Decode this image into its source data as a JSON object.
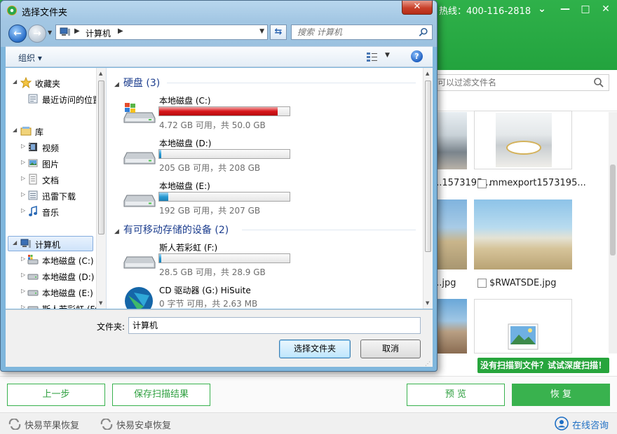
{
  "app": {
    "hotline": "热线：400-116-2818",
    "search_placeholder": "可以过滤文件名",
    "files": [
      {
        "name": "...1573195..."
      },
      {
        "name": "mmexport1573195..."
      },
      {
        "name": "...jpg"
      },
      {
        "name": "$RWATSDE.jpg"
      }
    ],
    "deep_scan": "没有扫描到文件？试试深度扫描！",
    "buttons": {
      "prev": "上一步",
      "save": "保存扫描结果",
      "preview": "预 览",
      "restore": "恢 复"
    },
    "footer": {
      "apple": "快易苹果恢复",
      "android": "快易安卓恢复",
      "online": "在线咨询"
    },
    "colors": {
      "brand_green": "#2fb14a",
      "link_blue": "#1e6fc4"
    }
  },
  "dialog": {
    "title": "选择文件夹",
    "address": "计算机",
    "search_placeholder": "搜索 计算机",
    "organize": "组织 ▾",
    "nav": {
      "favorites": "收藏夹",
      "recent": "最近访问的位置",
      "libraries": "库",
      "lib_items": [
        "视频",
        "图片",
        "文档",
        "迅雷下载",
        "音乐"
      ],
      "computer": "计算机",
      "computer_items": [
        "本地磁盘 (C:)",
        "本地磁盘 (D:)",
        "本地磁盘 (E:)",
        "斯人若彩虹 (F:)"
      ]
    },
    "groups": {
      "hard_disks": "硬盘 (3)",
      "removable": "有可移动存储的设备 (2)"
    },
    "drives": [
      {
        "name": "本地磁盘 (C:)",
        "info": "4.72 GB 可用，共 50.0 GB",
        "used": 0.906,
        "color": "red"
      },
      {
        "name": "本地磁盘 (D:)",
        "info": "205 GB 可用，共 208 GB",
        "used": 0.014,
        "color": "blue"
      },
      {
        "name": "本地磁盘 (E:)",
        "info": "192 GB 可用，共 207 GB",
        "used": 0.072,
        "color": "blue"
      },
      {
        "name": "斯人若彩虹 (F:)",
        "info": "28.5 GB 可用，共 28.9 GB",
        "used": 0.014,
        "color": "blue"
      },
      {
        "name": "CD 驱动器 (G:) HiSuite",
        "info": "0 字节 可用，共 2.63 MB",
        "used": 0,
        "color": "none"
      }
    ],
    "folder_label": "文件夹:",
    "folder_value": "计算机",
    "select_button": "选择文件夹",
    "cancel_button": "取消"
  }
}
